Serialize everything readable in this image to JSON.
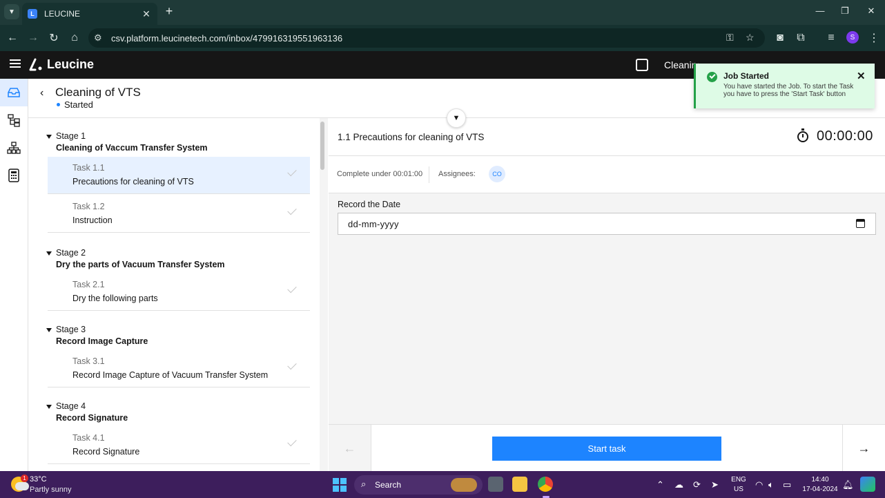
{
  "browser": {
    "tab_title": "LEUCINE",
    "tab_favicon": "L",
    "url": "csv.platform.leucinetech.com/inbox/479916319551963136",
    "profile_initial": "S",
    "icons": [
      "back-arrow-icon",
      "forward-arrow-icon",
      "reload-icon",
      "home-icon",
      "site-settings-icon",
      "password-key-icon",
      "bookmark-star-icon",
      "camera-icon",
      "extensions-icon",
      "media-icon",
      "menu-dots-icon"
    ]
  },
  "app": {
    "brand": "Leucine",
    "header_job": "Cleaning"
  },
  "job": {
    "title": "Cleaning of VTS",
    "status": "Started"
  },
  "stages": [
    {
      "number": "Stage 1",
      "name": "Cleaning of Vaccum Transfer System",
      "tasks": [
        {
          "number": "Task 1.1",
          "name": "Precautions for cleaning of VTS",
          "selected": true
        },
        {
          "number": "Task 1.2",
          "name": "Instruction",
          "selected": false
        }
      ]
    },
    {
      "number": "Stage 2",
      "name": "Dry the parts of Vacuum Transfer System",
      "tasks": [
        {
          "number": "Task 2.1",
          "name": "Dry the following parts",
          "selected": false
        }
      ]
    },
    {
      "number": "Stage 3",
      "name": "Record Image Capture",
      "tasks": [
        {
          "number": "Task 3.1",
          "name": "Record Image Capture of Vacuum Transfer System",
          "selected": false
        }
      ]
    },
    {
      "number": "Stage 4",
      "name": "Record Signature",
      "tasks": [
        {
          "number": "Task 4.1",
          "name": "Record Signature",
          "selected": false
        }
      ]
    }
  ],
  "task_view": {
    "title": "1.1 Precautions for cleaning of VTS",
    "timer": "00:00:00",
    "complete_under": "Complete under 00:01:00",
    "assignees_label": "Assignees:",
    "assignee_initials": "CO",
    "field_label": "Record the Date",
    "date_placeholder": "dd-mm-yyyy",
    "prev_arrow": "←",
    "next_arrow": "→",
    "start_button": "Start task"
  },
  "toast": {
    "title": "Job Started",
    "message": "You have started the Job. To start the Task you have to press the 'Start Task' button",
    "close": "✕"
  },
  "taskbar": {
    "temp": "33°C",
    "weather": "Partly sunny",
    "weather_badge": "1",
    "search": "Search",
    "lang_top": "ENG",
    "lang_bottom": "US",
    "time": "14:40",
    "date": "17-04-2024"
  }
}
